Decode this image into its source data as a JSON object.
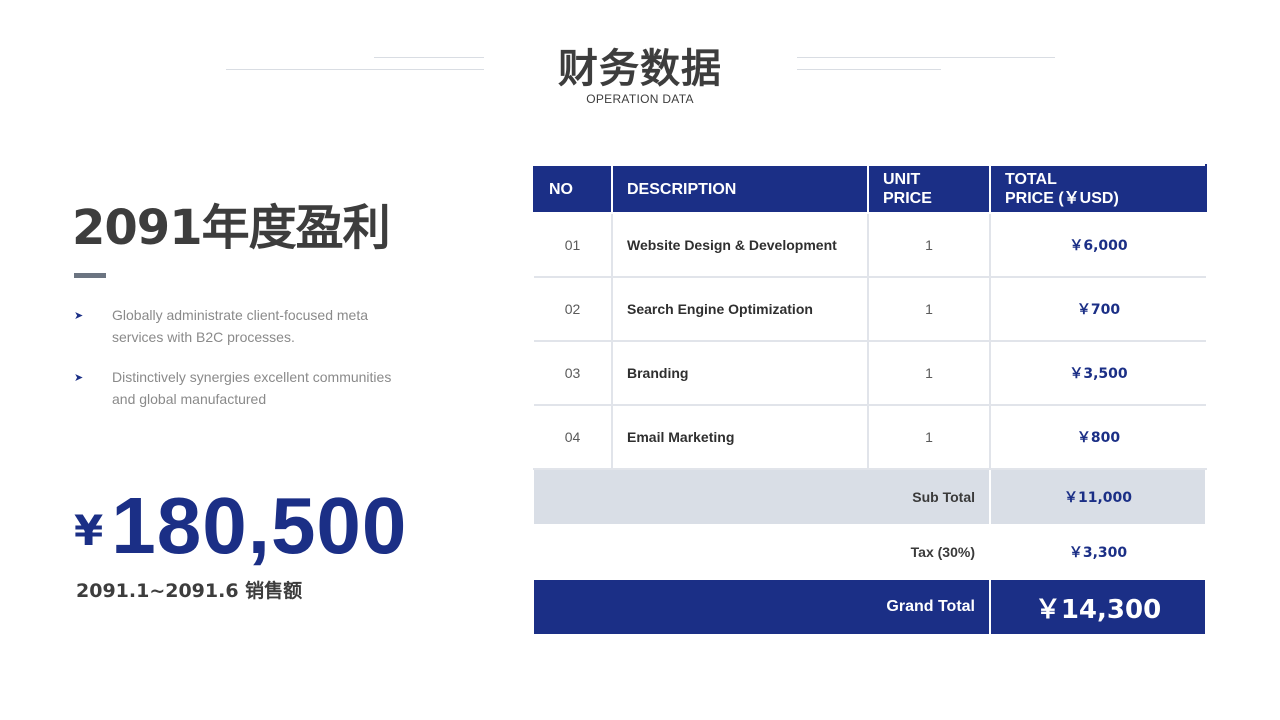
{
  "header": {
    "title": "财务数据",
    "subtitle": "OPERATION DATA"
  },
  "left": {
    "heading": "2091年度盈利",
    "bullets": [
      {
        "icon": "arrow-bullet-icon",
        "text": "Globally administrate client-focused meta services with B2C processes."
      },
      {
        "icon": "arrow-bullet-icon",
        "text": "Distinctively synergies excellent communities and global manufactured"
      }
    ],
    "bullet_marker": "➤",
    "currency_symbol": "¥",
    "amount": "180,500",
    "period": "2091.1~2091.6 销售额"
  },
  "table": {
    "headers": {
      "no": "NO",
      "description": "DESCRIPTION",
      "unit_price_1": "UNIT",
      "unit_price_2": "PRICE",
      "total_price_1": "TOTAL",
      "total_price_2": "PRICE (￥USD)"
    },
    "rows": [
      {
        "no": "01",
        "description": "Website Design & Development",
        "unit_price": "1",
        "total": "￥6,000"
      },
      {
        "no": "02",
        "description": "Search Engine Optimization",
        "unit_price": "1",
        "total": "￥700"
      },
      {
        "no": "03",
        "description": "Branding",
        "unit_price": "1",
        "total": "￥3,500"
      },
      {
        "no": "04",
        "description": "Email Marketing",
        "unit_price": "1",
        "total": "￥800"
      }
    ],
    "subtotal_label": "Sub Total",
    "subtotal_value": "￥11,000",
    "tax_label": "Tax (30%)",
    "tax_value": "￥3,300",
    "grand_label": "Grand Total",
    "grand_value": "￥14,300"
  },
  "colors": {
    "accent": "#1b2f86",
    "heading_text": "#3d3d3d",
    "muted_text": "#8a8a8a",
    "subtotal_bg": "#d9dee6"
  }
}
